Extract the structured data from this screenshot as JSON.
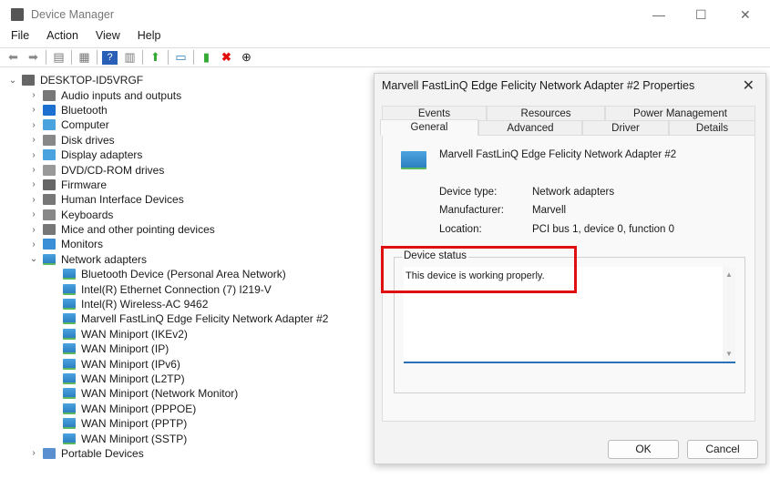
{
  "window": {
    "title": "Device Manager",
    "min": "—",
    "max": "☐",
    "close": "✕"
  },
  "menu": [
    "File",
    "Action",
    "View",
    "Help"
  ],
  "tree": {
    "root": "DESKTOP-ID5VRGF",
    "categories_before": [
      "Audio inputs and outputs",
      "Bluetooth",
      "Computer",
      "Disk drives",
      "Display adapters",
      "DVD/CD-ROM drives",
      "Firmware",
      "Human Interface Devices",
      "Keyboards",
      "Mice and other pointing devices",
      "Monitors"
    ],
    "expanded": "Network adapters",
    "children": [
      "Bluetooth Device (Personal Area Network)",
      "Intel(R) Ethernet Connection (7) I219-V",
      "Intel(R) Wireless-AC 9462",
      "Marvell FastLinQ Edge Felicity Network Adapter #2",
      "WAN Miniport (IKEv2)",
      "WAN Miniport (IP)",
      "WAN Miniport (IPv6)",
      "WAN Miniport (L2TP)",
      "WAN Miniport (Network Monitor)",
      "WAN Miniport (PPPOE)",
      "WAN Miniport (PPTP)",
      "WAN Miniport (SSTP)"
    ],
    "after": "Portable Devices"
  },
  "dialog": {
    "title": "Marvell FastLinQ Edge Felicity Network Adapter #2 Properties",
    "close": "✕",
    "tabs_top": [
      "Events",
      "Resources",
      "Power Management"
    ],
    "tabs_bottom": [
      "General",
      "Advanced",
      "Driver",
      "Details"
    ],
    "device_name": "Marvell FastLinQ Edge Felicity Network Adapter #2",
    "props": [
      {
        "label": "Device type:",
        "value": "Network adapters"
      },
      {
        "label": "Manufacturer:",
        "value": "Marvell"
      },
      {
        "label": "Location:",
        "value": "PCI bus 1, device 0, function 0"
      }
    ],
    "status_legend": "Device status",
    "status_text": "This device is working properly.",
    "ok": "OK",
    "cancel": "Cancel"
  },
  "colors": {
    "highlight": "#e01010",
    "accent": "#2a6fb8"
  }
}
